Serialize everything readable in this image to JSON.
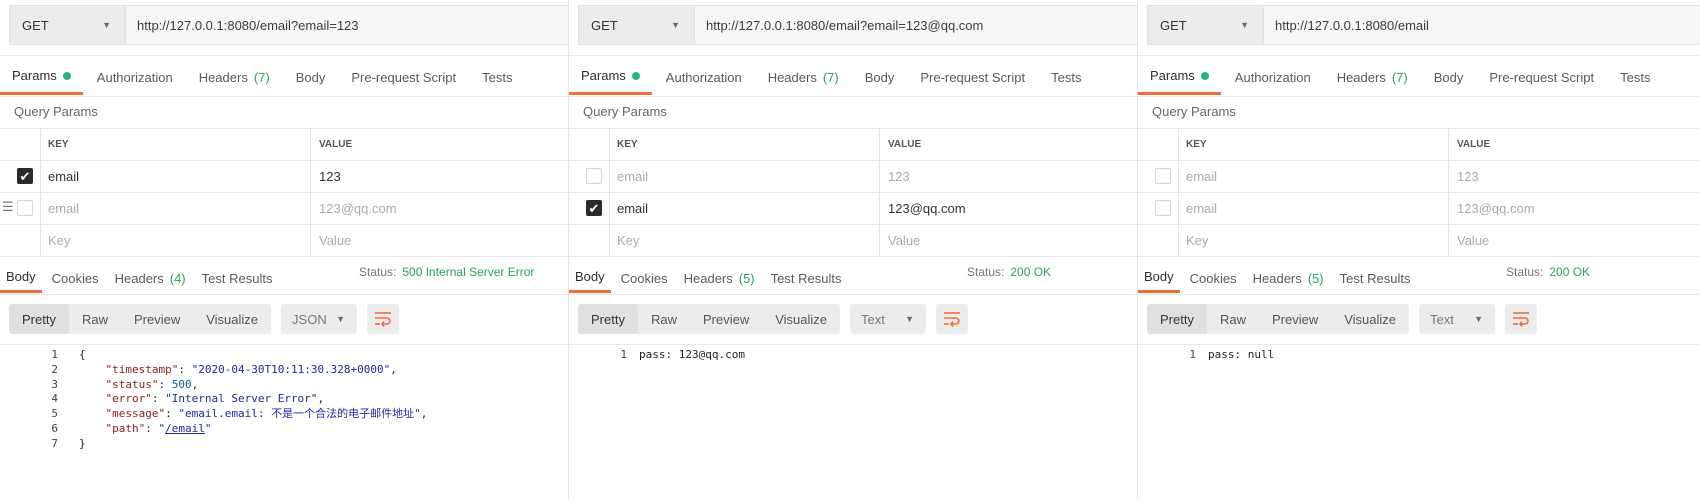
{
  "colors": {
    "accent": "#f26b3a",
    "success": "#26a65b",
    "dot": "#26b47f"
  },
  "panels": [
    {
      "method": "GET",
      "url": "http://127.0.0.1:8080/email?email=123",
      "request_tabs": [
        {
          "label": "Params",
          "active": true,
          "dot": true
        },
        {
          "label": "Authorization"
        },
        {
          "label": "Headers",
          "count": "(7)"
        },
        {
          "label": "Body"
        },
        {
          "label": "Pre-request Script"
        },
        {
          "label": "Tests"
        }
      ],
      "query_params_title": "Query Params",
      "table_header": {
        "key": "KEY",
        "value": "VALUE"
      },
      "rows": [
        {
          "key": "email",
          "value": "123",
          "checked": true
        },
        {
          "key": "email",
          "value": "123@qq.com",
          "checked": false,
          "drag": true
        }
      ],
      "placeholder": {
        "key": "Key",
        "value": "Value"
      },
      "response_tabs": [
        {
          "label": "Body",
          "active": true
        },
        {
          "label": "Cookies"
        },
        {
          "label": "Headers",
          "count": "(4)"
        },
        {
          "label": "Test Results"
        }
      ],
      "status_label": "Status:",
      "status_value": "500 Internal Server Error",
      "modes": [
        "Pretty",
        "Raw",
        "Preview",
        "Visualize"
      ],
      "format": "JSON",
      "code_type": "json",
      "code_lines": [
        {
          "n": "1",
          "text": "{"
        },
        {
          "n": "2",
          "key": "\"timestamp\"",
          "val": "\"2020-04-30T10:11:30.328+0000\"",
          "tail": ","
        },
        {
          "n": "3",
          "key": "\"status\"",
          "val": "500",
          "tail": ",",
          "num": true
        },
        {
          "n": "4",
          "key": "\"error\"",
          "val": "\"Internal Server Error\"",
          "tail": ","
        },
        {
          "n": "5",
          "key": "\"message\"",
          "val": "\"email.email: 不是一个合法的电子邮件地址\"",
          "tail": ","
        },
        {
          "n": "6",
          "key": "\"path\"",
          "val_pre": "\"",
          "val_link": "/email",
          "val_post": "\""
        },
        {
          "n": "7",
          "text": "}"
        }
      ]
    },
    {
      "method": "GET",
      "url": "http://127.0.0.1:8080/email?email=123@qq.com",
      "request_tabs": [
        {
          "label": "Params",
          "active": true,
          "dot": true
        },
        {
          "label": "Authorization"
        },
        {
          "label": "Headers",
          "count": "(7)"
        },
        {
          "label": "Body"
        },
        {
          "label": "Pre-request Script"
        },
        {
          "label": "Tests"
        }
      ],
      "query_params_title": "Query Params",
      "table_header": {
        "key": "KEY",
        "value": "VALUE"
      },
      "rows": [
        {
          "key": "email",
          "value": "123",
          "checked": false
        },
        {
          "key": "email",
          "value": "123@qq.com",
          "checked": true
        }
      ],
      "placeholder": {
        "key": "Key",
        "value": "Value"
      },
      "response_tabs": [
        {
          "label": "Body",
          "active": true
        },
        {
          "label": "Cookies"
        },
        {
          "label": "Headers",
          "count": "(5)"
        },
        {
          "label": "Test Results"
        }
      ],
      "status_label": "Status:",
      "status_value": "200 OK",
      "modes": [
        "Pretty",
        "Raw",
        "Preview",
        "Visualize"
      ],
      "format": "Text",
      "code_type": "text",
      "code_lines": [
        {
          "n": "1",
          "text": "pass: 123@qq.com"
        }
      ]
    },
    {
      "method": "GET",
      "url": "http://127.0.0.1:8080/email",
      "request_tabs": [
        {
          "label": "Params",
          "active": true,
          "dot": true
        },
        {
          "label": "Authorization"
        },
        {
          "label": "Headers",
          "count": "(7)"
        },
        {
          "label": "Body"
        },
        {
          "label": "Pre-request Script"
        },
        {
          "label": "Tests"
        }
      ],
      "query_params_title": "Query Params",
      "table_header": {
        "key": "KEY",
        "value": "VALUE"
      },
      "rows": [
        {
          "key": "email",
          "value": "123",
          "checked": false
        },
        {
          "key": "email",
          "value": "123@qq.com",
          "checked": false
        }
      ],
      "placeholder": {
        "key": "Key",
        "value": "Value"
      },
      "response_tabs": [
        {
          "label": "Body",
          "active": true
        },
        {
          "label": "Cookies"
        },
        {
          "label": "Headers",
          "count": "(5)"
        },
        {
          "label": "Test Results"
        }
      ],
      "status_label": "Status:",
      "status_value": "200 OK",
      "modes": [
        "Pretty",
        "Raw",
        "Preview",
        "Visualize"
      ],
      "format": "Text",
      "code_type": "text",
      "code_lines": [
        {
          "n": "1",
          "text": "pass: null"
        }
      ]
    }
  ]
}
